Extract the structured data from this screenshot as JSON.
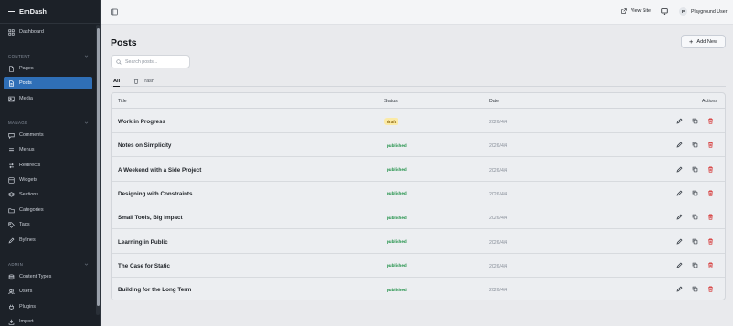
{
  "app": {
    "brand": "EmDash"
  },
  "sidebar": {
    "sections": [
      {
        "label": "CONTENT"
      },
      {
        "label": "MANAGE"
      },
      {
        "label": "ADMIN"
      }
    ],
    "items": [
      {
        "label": "Dashboard",
        "icon": "grid-icon"
      },
      {
        "label": "Pages",
        "icon": "file-icon"
      },
      {
        "label": "Posts",
        "icon": "document-icon",
        "active": true
      },
      {
        "label": "Media",
        "icon": "image-icon"
      },
      {
        "label": "Comments",
        "icon": "comment-icon"
      },
      {
        "label": "Menus",
        "icon": "menu-icon"
      },
      {
        "label": "Redirects",
        "icon": "redirect-icon"
      },
      {
        "label": "Widgets",
        "icon": "widget-icon"
      },
      {
        "label": "Sections",
        "icon": "layers-icon"
      },
      {
        "label": "Categories",
        "icon": "folder-icon"
      },
      {
        "label": "Tags",
        "icon": "tag-icon"
      },
      {
        "label": "Bylines",
        "icon": "pen-icon"
      },
      {
        "label": "Content Types",
        "icon": "database-icon"
      },
      {
        "label": "Users",
        "icon": "users-icon"
      },
      {
        "label": "Plugins",
        "icon": "plug-icon"
      },
      {
        "label": "Import",
        "icon": "import-icon"
      }
    ]
  },
  "topbar": {
    "view_site": "View Site",
    "user_initial": "P",
    "user_name": "Playground User"
  },
  "main": {
    "title": "Posts",
    "add_new": "Add New",
    "search_placeholder": "Search posts...",
    "tabs": [
      {
        "label": "All",
        "active": true
      },
      {
        "label": "Trash",
        "active": false
      }
    ],
    "columns": {
      "title": "Title",
      "status": "Status",
      "date": "Date",
      "actions": "Actions"
    },
    "rows": [
      {
        "title": "Work in Progress",
        "status": "draft",
        "date": "2026/4/4"
      },
      {
        "title": "Notes on Simplicity",
        "status": "published",
        "date": "2026/4/4"
      },
      {
        "title": "A Weekend with a Side Project",
        "status": "published",
        "date": "2026/4/4"
      },
      {
        "title": "Designing with Constraints",
        "status": "published",
        "date": "2026/4/4"
      },
      {
        "title": "Small Tools, Big Impact",
        "status": "published",
        "date": "2026/4/4"
      },
      {
        "title": "Learning in Public",
        "status": "published",
        "date": "2026/4/4"
      },
      {
        "title": "The Case for Static",
        "status": "published",
        "date": "2026/4/4"
      },
      {
        "title": "Building for the Long Term",
        "status": "published",
        "date": "2026/4/4"
      }
    ]
  },
  "colors": {
    "sidebar_bg": "#1c2128",
    "active_item": "#2f6fb7",
    "draft_badge_bg": "#fbeaa6",
    "published_text": "#1d8f45",
    "delete_icon": "#d63b3b"
  }
}
